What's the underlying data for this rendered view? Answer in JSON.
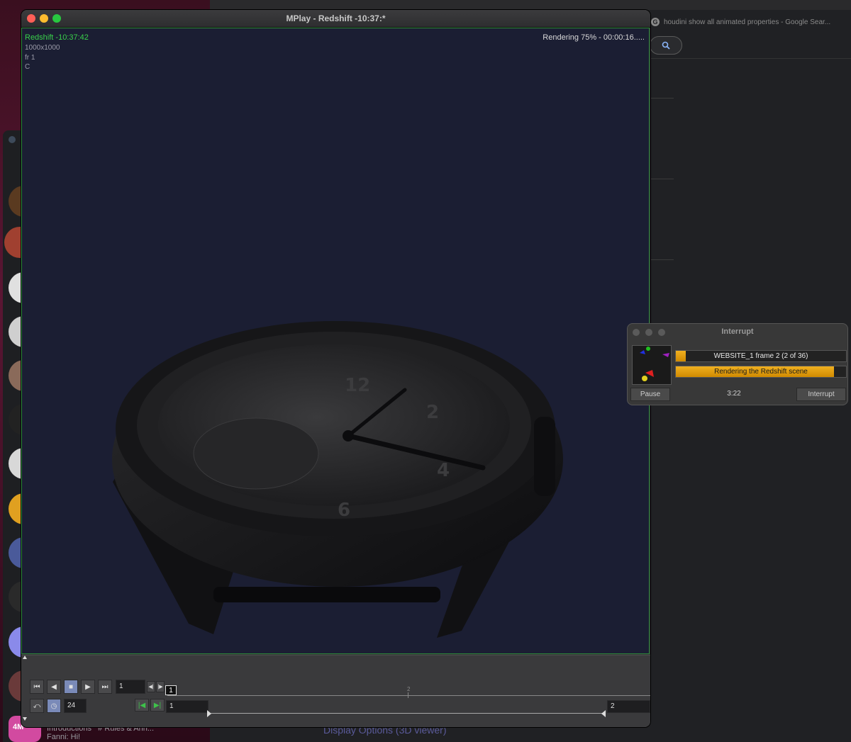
{
  "browser": {
    "tab_title": "houdini show all animated properties - Google Sear...",
    "favicon_letter": "G"
  },
  "discord": {
    "channel_1": "Introductions",
    "channel_2": "Rules & Ann...",
    "message_preview": "Fanni: Hi!",
    "server_badge": "4M"
  },
  "background_text": "Display Options (3D viewer)",
  "mplay": {
    "title": "MPlay - Redshift -10:37:*",
    "overlay": {
      "name": "Redshift -10:37:42",
      "resolution": "1000x1000",
      "frame": "fr 1",
      "channel": "C"
    },
    "status": "Rendering 75% - 00:00:16.....",
    "playbar": {
      "current_frame": "1",
      "fps": "24",
      "range_start": "1",
      "range_end": "2",
      "timeline_tick": "2",
      "frame_marker": "1"
    }
  },
  "interrupt": {
    "title": "Interrupt",
    "job_label": "WEBSITE_1 frame 2 (2 of 36)",
    "job_progress": 0.06,
    "task_label": "Rendering the Redshift scene",
    "task_progress": 0.93,
    "elapsed": "3:22",
    "pause_label": "Pause",
    "interrupt_label": "Interrupt"
  },
  "colors": {
    "overlay_green": "#39d04a",
    "viewport_bg": "#1b1e33",
    "progress_orange": "#e8a010",
    "traffic_red": "#ff5f57",
    "traffic_yellow": "#febc2e",
    "traffic_green": "#28c840"
  }
}
